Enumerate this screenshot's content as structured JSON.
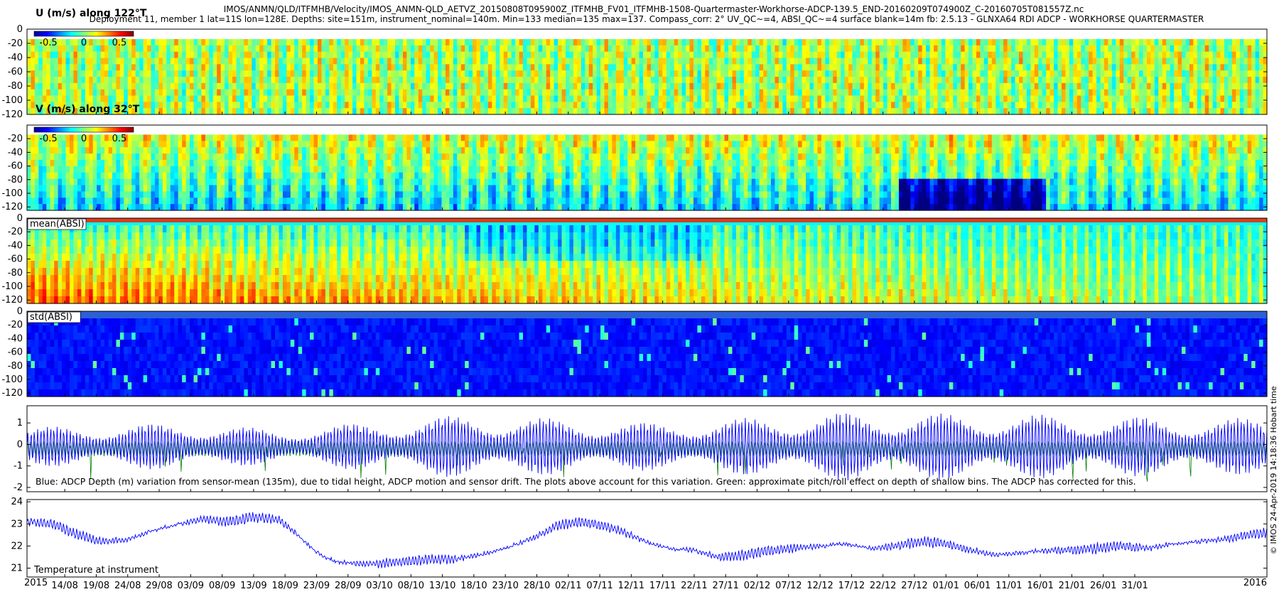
{
  "header": {
    "line1": "IMOS/ANMN/QLD/ITFMHB/Velocity/IMOS_ANMN-QLD_AETVZ_20150808T095900Z_ITFMHB_FV01_ITFMHB-1508-Quartermaster-Workhorse-ADCP-139.5_END-20160209T074900Z_C-20160705T081557Z.nc",
    "line2": "Deployment 11, member 1 lat=11S lon=128E. Depths: site=151m, instrument_nominal=140m. Min=133 median=135 max=137. Compass_corr: 2° UV_QC~=4, ABSI_QC~=4 surface blank=14m fb: 2.5.13 - GLNXA64 RDI ADCP - WORKHORSE QUARTERMASTER"
  },
  "side_label": "© IMOS 24-Apr-2019 14:18:36 Hobart time",
  "chart_data": [
    {
      "type": "heatmap",
      "label": "U (m/s) along 122°T",
      "colorbar_ticks": [
        "-0.5",
        "0",
        "0.5"
      ],
      "clim": [
        -0.7,
        0.7
      ],
      "y_ticks": [
        0,
        -20,
        -40,
        -60,
        -80,
        -100,
        -120
      ],
      "ylim": [
        -120,
        0
      ],
      "blank_above": -14
    },
    {
      "type": "heatmap",
      "label": "V (m/s) along 32°T",
      "colorbar_ticks": [
        "-0.5",
        "0",
        "0.5"
      ],
      "clim": [
        -0.7,
        0.7
      ],
      "y_ticks": [
        -20,
        -40,
        -60,
        -80,
        -100,
        -120
      ],
      "ylim": [
        -125,
        0
      ],
      "blank_above": -14
    },
    {
      "type": "heatmap",
      "label": "mean(ABSI)",
      "y_ticks": [
        0,
        -20,
        -40,
        -60,
        -80,
        -100,
        -120
      ],
      "ylim": [
        -125,
        0
      ]
    },
    {
      "type": "heatmap",
      "label": "std(ABSI)",
      "y_ticks": [
        0,
        -20,
        -40,
        -60,
        -80,
        -100,
        -120
      ],
      "ylim": [
        -125,
        0
      ]
    },
    {
      "type": "line",
      "y_ticks": [
        1,
        0,
        -1,
        -2
      ],
      "ylim": [
        -2.2,
        1.8
      ],
      "annotation": "Blue: ADCP Depth (m) variation from sensor-mean (135m), due to tidal height, ADCP motion and sensor drift. The plots above account for this variation. Green: approximate pitch/roll effect on depth of shallow bins. The ADCP has corrected for this.",
      "series": [
        {
          "color": "#0000ff",
          "envelope": [
            [
              0,
              0.9
            ],
            [
              25,
              1.1
            ],
            [
              40,
              0.8
            ],
            [
              70,
              1.5
            ],
            [
              100,
              1.1
            ],
            [
              130,
              1.6
            ],
            [
              160,
              1.5
            ],
            [
              190,
              1.3
            ],
            [
              200,
              1.4
            ]
          ]
        },
        {
          "color": "#008000"
        }
      ]
    },
    {
      "type": "line",
      "label": "Temperature at instrument",
      "y_ticks": [
        24,
        23,
        22,
        21
      ],
      "ylim": [
        20.6,
        24.1
      ],
      "series": [
        {
          "color": "#0000ff",
          "points": [
            [
              0,
              23.1
            ],
            [
              4,
              23.0
            ],
            [
              8,
              22.5
            ],
            [
              12,
              22.2
            ],
            [
              16,
              22.3
            ],
            [
              20,
              22.7
            ],
            [
              24,
              23.0
            ],
            [
              28,
              23.2
            ],
            [
              32,
              23.1
            ],
            [
              36,
              23.3
            ],
            [
              40,
              23.2
            ],
            [
              43,
              22.5
            ],
            [
              46,
              21.7
            ],
            [
              49,
              21.3
            ],
            [
              52,
              21.2
            ],
            [
              56,
              21.2
            ],
            [
              60,
              21.3
            ],
            [
              64,
              21.4
            ],
            [
              68,
              21.4
            ],
            [
              72,
              21.6
            ],
            [
              76,
              21.9
            ],
            [
              80,
              22.3
            ],
            [
              84,
              22.9
            ],
            [
              88,
              23.1
            ],
            [
              92,
              22.9
            ],
            [
              96,
              22.5
            ],
            [
              99,
              22.1
            ],
            [
              102,
              21.9
            ],
            [
              106,
              21.8
            ],
            [
              110,
              21.5
            ],
            [
              114,
              21.6
            ],
            [
              118,
              21.8
            ],
            [
              122,
              21.9
            ],
            [
              126,
              22.0
            ],
            [
              130,
              22.1
            ],
            [
              134,
              21.9
            ],
            [
              138,
              22.0
            ],
            [
              142,
              22.2
            ],
            [
              146,
              22.1
            ],
            [
              150,
              21.8
            ],
            [
              154,
              21.6
            ],
            [
              158,
              21.7
            ],
            [
              162,
              21.8
            ],
            [
              166,
              21.8
            ],
            [
              170,
              21.9
            ],
            [
              174,
              22.0
            ],
            [
              178,
              21.9
            ],
            [
              182,
              22.1
            ],
            [
              186,
              22.2
            ],
            [
              190,
              22.3
            ],
            [
              194,
              22.5
            ],
            [
              197,
              22.6
            ]
          ]
        }
      ]
    }
  ],
  "x_axis": {
    "year_start": "2015",
    "year_end": "2016",
    "day_span": 197,
    "ticks": [
      {
        "day": 6,
        "label": "14/08"
      },
      {
        "day": 11,
        "label": "19/08"
      },
      {
        "day": 16,
        "label": "24/08"
      },
      {
        "day": 21,
        "label": "29/08"
      },
      {
        "day": 26,
        "label": "03/09"
      },
      {
        "day": 31,
        "label": "08/09"
      },
      {
        "day": 36,
        "label": "13/09"
      },
      {
        "day": 41,
        "label": "18/09"
      },
      {
        "day": 46,
        "label": "23/09"
      },
      {
        "day": 51,
        "label": "28/09"
      },
      {
        "day": 56,
        "label": "03/10"
      },
      {
        "day": 61,
        "label": "08/10"
      },
      {
        "day": 66,
        "label": "13/10"
      },
      {
        "day": 71,
        "label": "18/10"
      },
      {
        "day": 76,
        "label": "23/10"
      },
      {
        "day": 81,
        "label": "28/10"
      },
      {
        "day": 86,
        "label": "02/11"
      },
      {
        "day": 91,
        "label": "07/11"
      },
      {
        "day": 96,
        "label": "12/11"
      },
      {
        "day": 101,
        "label": "17/11"
      },
      {
        "day": 106,
        "label": "22/11"
      },
      {
        "day": 111,
        "label": "27/11"
      },
      {
        "day": 116,
        "label": "02/12"
      },
      {
        "day": 121,
        "label": "07/12"
      },
      {
        "day": 126,
        "label": "12/12"
      },
      {
        "day": 131,
        "label": "17/12"
      },
      {
        "day": 136,
        "label": "22/12"
      },
      {
        "day": 141,
        "label": "27/12"
      },
      {
        "day": 146,
        "label": "01/01"
      },
      {
        "day": 151,
        "label": "06/01"
      },
      {
        "day": 156,
        "label": "11/01"
      },
      {
        "day": 161,
        "label": "16/01"
      },
      {
        "day": 166,
        "label": "21/01"
      },
      {
        "day": 171,
        "label": "26/01"
      },
      {
        "day": 176,
        "label": "31/01"
      }
    ]
  }
}
